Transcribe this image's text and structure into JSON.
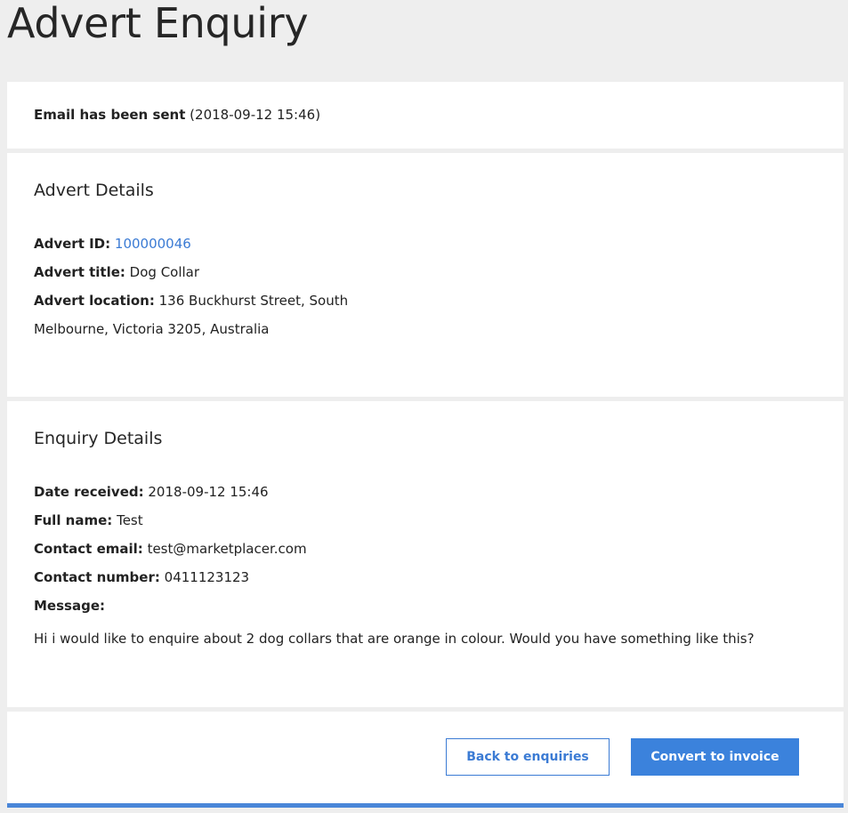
{
  "page": {
    "title": "Advert Enquiry"
  },
  "status": {
    "label": "Email has been sent",
    "timestamp": "(2018-09-12 15:46)"
  },
  "advert": {
    "heading": "Advert Details",
    "id_label": "Advert ID:",
    "id_value": "100000046",
    "title_label": "Advert title:",
    "title_value": "Dog Collar",
    "location_label": "Advert location:",
    "location_value": "136 Buckhurst Street, South Melbourne, Victoria 3205, Australia"
  },
  "enquiry": {
    "heading": "Enquiry Details",
    "date_label": "Date received:",
    "date_value": "2018-09-12 15:46",
    "name_label": "Full name:",
    "name_value": "Test",
    "email_label": "Contact email:",
    "email_value": "test@marketplacer.com",
    "number_label": "Contact number:",
    "number_value": "0411123123",
    "message_label": "Message:",
    "message_value": "Hi i would like to enquire about 2 dog collars that are orange in colour. Would you have something like this?"
  },
  "actions": {
    "back_label": "Back to enquiries",
    "convert_label": "Convert to invoice"
  },
  "colors": {
    "accent": "#3b82dc",
    "link": "#3b7bd4",
    "background": "#eeeeee",
    "card": "#ffffff"
  }
}
